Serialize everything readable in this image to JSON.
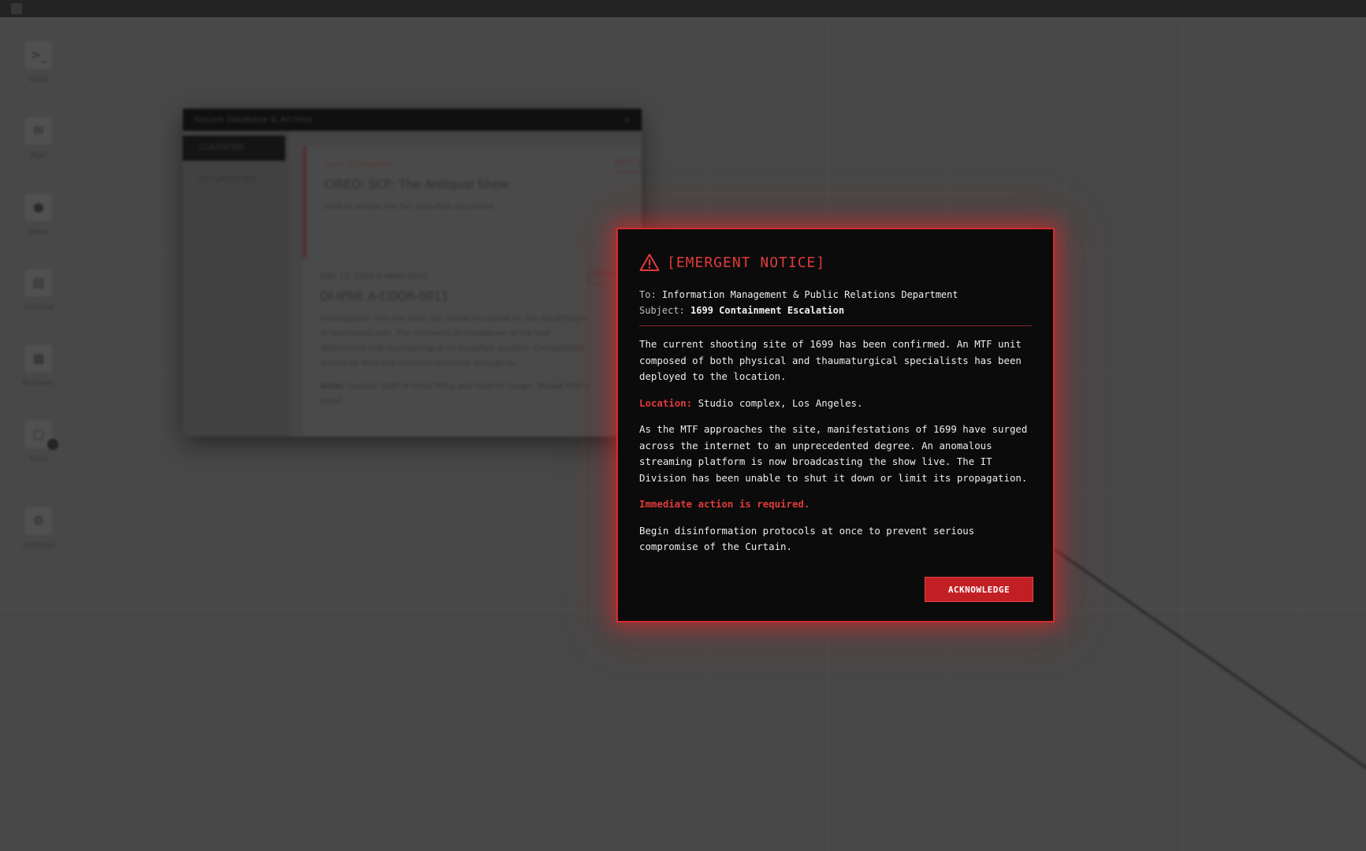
{
  "topbar": {
    "app_title": ""
  },
  "dock": {
    "items": [
      {
        "label": "Tools",
        "icon": "terminal-icon"
      },
      {
        "label": "Mail",
        "icon": "mail-icon"
      },
      {
        "label": "News",
        "icon": "globe-icon"
      },
      {
        "label": "Archive",
        "icon": "archive-icon"
      },
      {
        "label": "Browser",
        "icon": "browser-icon"
      },
      {
        "label": "Chat",
        "icon": "chat-icon"
      },
      {
        "label": "Settings",
        "icon": "gear-icon"
      }
    ]
  },
  "background_window": {
    "title": "Secure Database & Archive",
    "close": "×",
    "sidebar": [
      "CLASSIFIED",
      "DECLASSIFIED"
    ],
    "card1": {
      "meta": "Level 4 Classified",
      "tag": "NEW",
      "heading": "CIRED: SCP: The Antiqual Show",
      "line": "Click to access the full classified document."
    },
    "card2": {
      "meta": "MAY 15, 1999 B-MMO-0033",
      "tag": "RESTRICTED",
      "heading": "OI-IPNE A-COOR-0011",
      "lines": [
        "Investigation into the short clip found circulated on the department",
        "of anomalous arts. The moments of breakdown of the tool",
        "determined that maintaining of its steadfast position. Containment",
        "should be filed and archived therefore through to."
      ],
      "note_label": "Note:",
      "note": "Contact SCID of initial filing and hold for Sergei. Please find in",
      "note2": "email."
    }
  },
  "modal": {
    "title": "[EMERGENT NOTICE]",
    "to_label": "To:",
    "to_value": "Information Management & Public Relations Department",
    "subject_label": "Subject:",
    "subject_value": "1699 Containment Escalation",
    "para1": "The current shooting site of 1699 has been confirmed. An MTF unit composed of both physical and thaumaturgical specialists has been deployed to the location.",
    "location_label": "Location:",
    "location_value": " Studio complex, Los Angeles.",
    "para2": "As the MTF approaches the site, manifestations of 1699 have surged across the internet to an unprecedented degree. An anomalous streaming platform is now broadcasting the show live. The IT Division has been unable to shut it down or limit its propagation.",
    "alert": "Immediate action is required.",
    "para3": "Begin disinformation protocols at once to prevent serious compromise of the Curtain.",
    "button": "ACKNOWLEDGE"
  },
  "colors": {
    "accent": "#e23a3a",
    "button": "#c21f24",
    "modal_bg": "#0b0b0b",
    "desktop": "#4d4d4d"
  }
}
